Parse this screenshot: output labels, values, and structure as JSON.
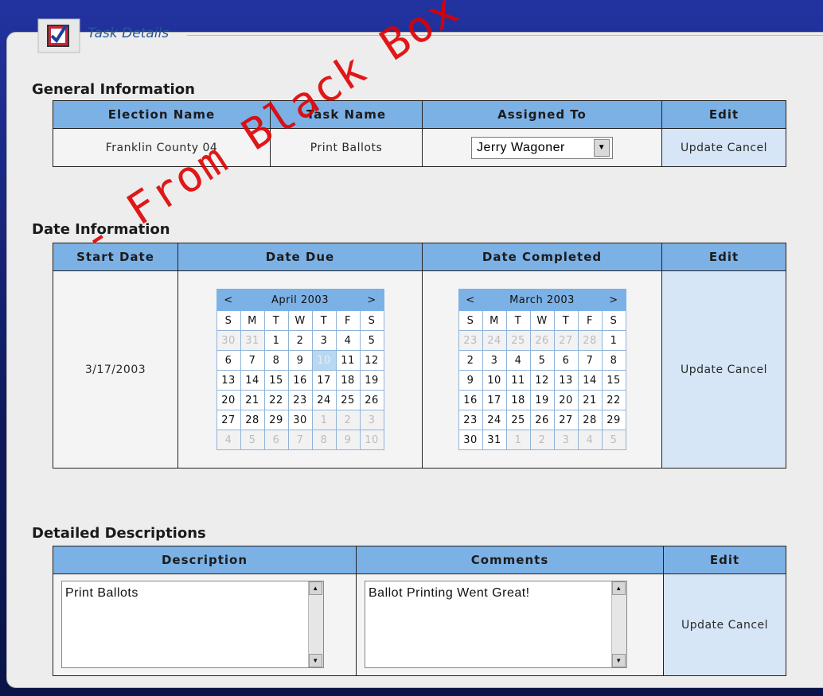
{
  "panel": {
    "title": "Task Details"
  },
  "general": {
    "section_title": "General Information",
    "headers": [
      "Election Name",
      "Task Name",
      "Assigned To",
      "Edit"
    ],
    "election_name": "Franklin County 04",
    "task_name": "Print Ballots",
    "assigned_to": "Jerry Wagoner",
    "update_label": "Update",
    "cancel_label": "Cancel"
  },
  "dates": {
    "section_title": "Date Information",
    "headers": [
      "Start Date",
      "Date Due",
      "Date Completed",
      "Edit"
    ],
    "start_date": "3/17/2003",
    "update_label": "Update",
    "cancel_label": "Cancel",
    "due_calendar": {
      "month": "April 2003",
      "prev": "<",
      "next": ">",
      "dow": [
        "S",
        "M",
        "T",
        "W",
        "T",
        "F",
        "S"
      ],
      "weeks": [
        [
          "30",
          "31",
          "1",
          "2",
          "3",
          "4",
          "5"
        ],
        [
          "6",
          "7",
          "8",
          "9",
          "10",
          "11",
          "12"
        ],
        [
          "13",
          "14",
          "15",
          "16",
          "17",
          "18",
          "19"
        ],
        [
          "20",
          "21",
          "22",
          "23",
          "24",
          "25",
          "26"
        ],
        [
          "27",
          "28",
          "29",
          "30",
          "1",
          "2",
          "3"
        ],
        [
          "4",
          "5",
          "6",
          "7",
          "8",
          "9",
          "10"
        ]
      ],
      "other": [
        [
          0,
          0
        ],
        [
          0,
          1
        ],
        [
          4,
          4
        ],
        [
          4,
          5
        ],
        [
          4,
          6
        ],
        [
          5,
          0
        ],
        [
          5,
          1
        ],
        [
          5,
          2
        ],
        [
          5,
          3
        ],
        [
          5,
          4
        ],
        [
          5,
          5
        ],
        [
          5,
          6
        ]
      ],
      "selected": [
        1,
        4
      ]
    },
    "completed_calendar": {
      "month": "March 2003",
      "prev": "<",
      "next": ">",
      "dow": [
        "S",
        "M",
        "T",
        "W",
        "T",
        "F",
        "S"
      ],
      "weeks": [
        [
          "23",
          "24",
          "25",
          "26",
          "27",
          "28",
          "1"
        ],
        [
          "2",
          "3",
          "4",
          "5",
          "6",
          "7",
          "8"
        ],
        [
          "9",
          "10",
          "11",
          "12",
          "13",
          "14",
          "15"
        ],
        [
          "16",
          "17",
          "18",
          "19",
          "20",
          "21",
          "22"
        ],
        [
          "23",
          "24",
          "25",
          "26",
          "27",
          "28",
          "29"
        ],
        [
          "30",
          "31",
          "1",
          "2",
          "3",
          "4",
          "5"
        ]
      ],
      "other": [
        [
          0,
          0
        ],
        [
          0,
          1
        ],
        [
          0,
          2
        ],
        [
          0,
          3
        ],
        [
          0,
          4
        ],
        [
          0,
          5
        ],
        [
          5,
          2
        ],
        [
          5,
          3
        ],
        [
          5,
          4
        ],
        [
          5,
          5
        ],
        [
          5,
          6
        ]
      ],
      "selected": null
    }
  },
  "details": {
    "section_title": "Detailed Descriptions",
    "headers": [
      "Description",
      "Comments",
      "Edit"
    ],
    "description": "Print Ballots",
    "comments": "Ballot Printing Went Great!",
    "update_label": "Update",
    "cancel_label": "Cancel"
  },
  "watermark": "- From Black Box Voting Documents"
}
